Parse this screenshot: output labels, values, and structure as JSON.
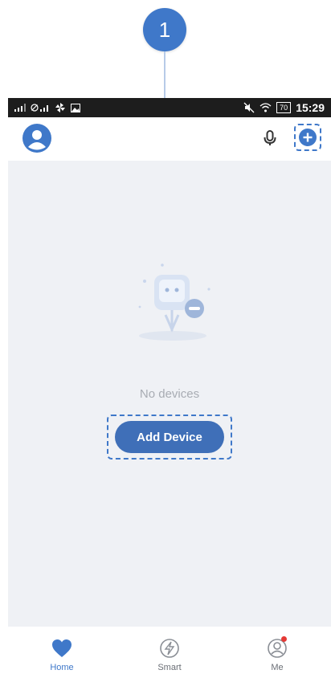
{
  "callout": {
    "number": "1"
  },
  "status_bar": {
    "time": "15:29",
    "battery": "70"
  },
  "header": {
    "icons": [
      "avatar-icon",
      "microphone-icon",
      "add-icon"
    ]
  },
  "main": {
    "empty_text": "No devices",
    "add_button_label": "Add Device",
    "illustration": "empty-devices-illustration"
  },
  "bottom_nav": {
    "items": [
      {
        "label": "Home",
        "icon": "heart-home-icon",
        "active": true
      },
      {
        "label": "Smart",
        "icon": "lightning-icon",
        "active": false
      },
      {
        "label": "Me",
        "icon": "user-icon",
        "active": false,
        "badge": true
      }
    ]
  },
  "colors": {
    "accent": "#3f78c9",
    "button": "#3f6fb8",
    "background": "#eff1f5",
    "status_bar": "#1d1d1d",
    "badge": "#e53935"
  }
}
